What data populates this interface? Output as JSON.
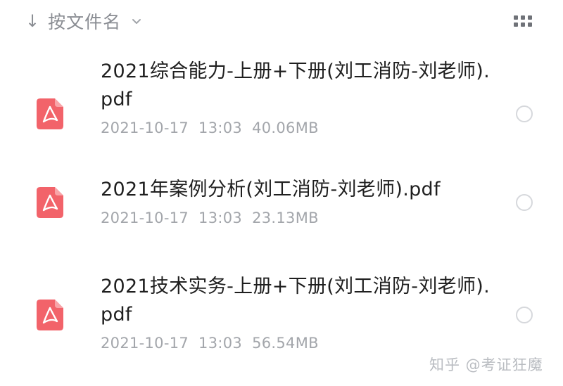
{
  "toolbar": {
    "sort_arrow": "↓",
    "sort_label": "按文件名",
    "sort_chevron_icon": "chevron-down-icon",
    "view_toggle_icon": "grid-view-icon"
  },
  "files": [
    {
      "name": "2021综合能力-上册+下册(刘工消防-刘老师).pdf",
      "date": "2021-10-17",
      "time": "13:03",
      "size": "40.06MB",
      "icon": "pdf-file-icon"
    },
    {
      "name": "2021年案例分析(刘工消防-刘老师).pdf",
      "date": "2021-10-17",
      "time": "13:03",
      "size": "23.13MB",
      "icon": "pdf-file-icon"
    },
    {
      "name": "2021技术实务-上册+下册(刘工消防-刘老师).pdf",
      "date": "2021-10-17",
      "time": "13:03",
      "size": "56.54MB",
      "icon": "pdf-file-icon"
    }
  ],
  "watermark": "知乎 @考证狂魔",
  "colors": {
    "pdf_icon": "#f2636a",
    "muted_text": "#a3a6ab",
    "toolbar_text": "#8a8d93",
    "radio_border": "#d6d8dc"
  }
}
